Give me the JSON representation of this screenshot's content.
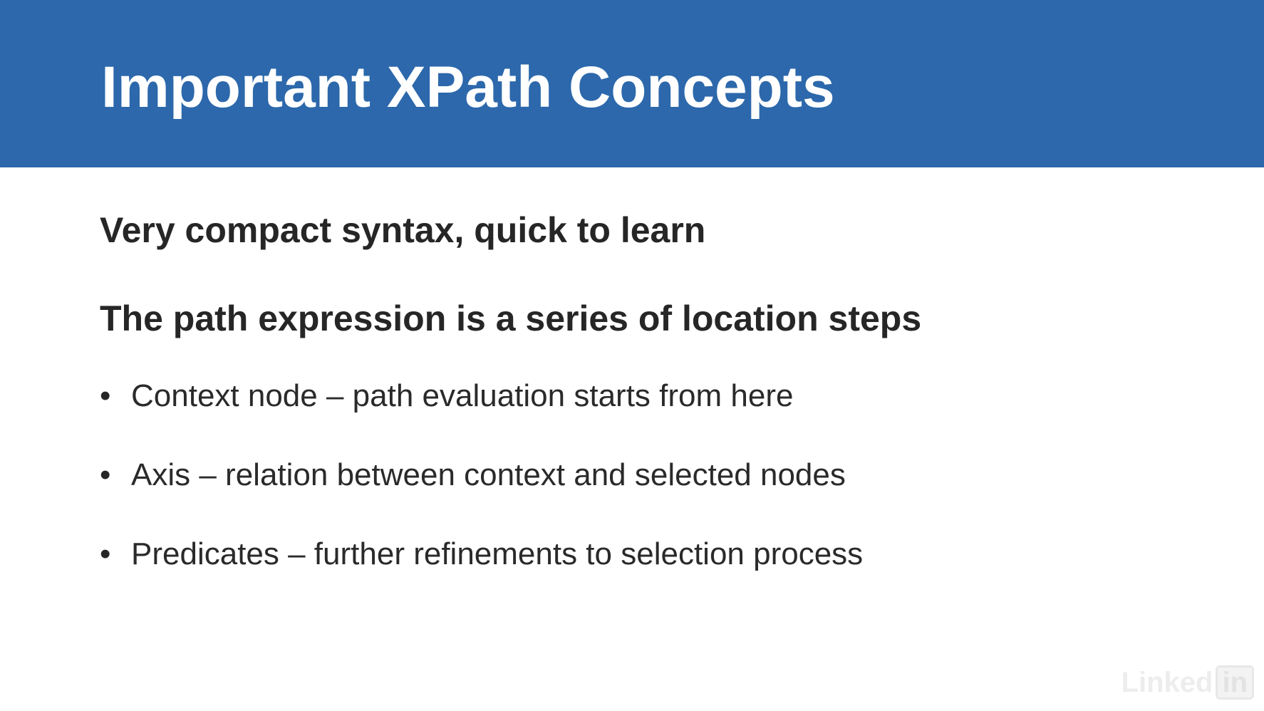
{
  "slide": {
    "title": "Important XPath Concepts",
    "headings": [
      "Very compact syntax, quick to learn",
      "The path expression is a series of location steps"
    ],
    "bullets": [
      "Context node – path evaluation starts from here",
      "Axis – relation between context and selected nodes",
      "Predicates – further refinements to selection process"
    ],
    "bullet_symbol": "•"
  },
  "watermark": {
    "logo_text": "Linked",
    "logo_badge": "in"
  },
  "colors": {
    "title_bar": "#2c68ab",
    "title_text": "#ffffff",
    "body_text": "#262626"
  }
}
